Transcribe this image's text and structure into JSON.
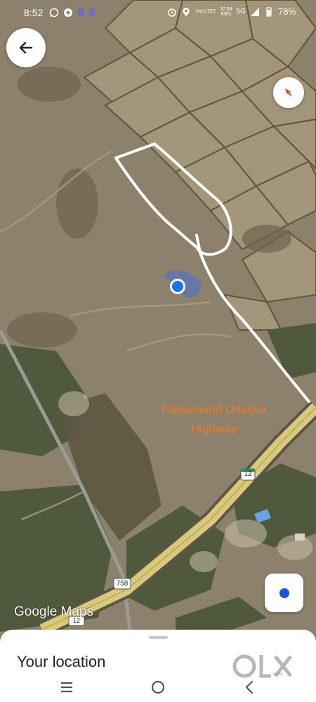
{
  "status_bar": {
    "time": "8:52",
    "s_icon_1": "S",
    "s_icon_2": "S",
    "net_speed_value": "37.69",
    "net_speed_unit": "KB/s",
    "volte": "Vo) LTE2",
    "network": "5G",
    "battery": "78%",
    "icons": [
      "whatsapp-icon",
      "settings-icon",
      "alarm-icon",
      "location-icon",
      "wifi-icon",
      "signal-icon",
      "battery-icon"
    ]
  },
  "map": {
    "annotation_line1": "Rajsamand Udaipur",
    "annotation_line2": "Highway",
    "highway_shield_1": "12",
    "highway_shield_2": "758",
    "highway_shield_3": "12",
    "logo": "Google Maps",
    "accent_color": "#1a73e8",
    "road_color": "#d9c97a",
    "annotation_color": "#f07a26",
    "drawing_color": "#ffffff"
  },
  "controls": {
    "back_icon": "arrow-left-icon",
    "compass_icon": "compass-icon",
    "my_location_icon": "my-location-icon"
  },
  "sheet": {
    "title": "Your location",
    "watermark": "OLX",
    "watermark_sub": "INDIA"
  },
  "nav": {
    "icons": [
      "recent-apps-icon",
      "home-icon",
      "back-icon"
    ]
  }
}
